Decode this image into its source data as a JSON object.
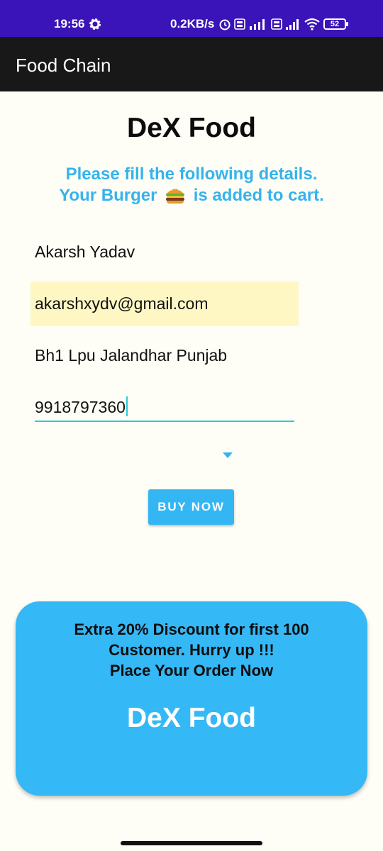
{
  "status_bar": {
    "time": "19:56",
    "network_speed": "0.2KB/s",
    "battery": "52",
    "icons": [
      "gear-icon",
      "alarm-icon",
      "volte-icon",
      "signal-5g-icon",
      "volte-icon",
      "signal-icon",
      "wifi-icon",
      "battery-icon"
    ]
  },
  "app_bar": {
    "title": "Food Chain"
  },
  "header": {
    "brand": "DeX Food",
    "subtitle_line1": "Please fill the following details.",
    "subtitle_line2_before": "Your Burger",
    "subtitle_line2_after": "is added to cart.",
    "subtitle_icon": "burger-emoji-icon"
  },
  "form": {
    "name": "Akarsh Yadav",
    "email": "akarshxydv@gmail.com",
    "address": "Bh1 Lpu Jalandhar Punjab",
    "phone": "9918797360",
    "dropdown_icon": "dropdown-arrow-icon"
  },
  "buy_button": {
    "label": "BUY NOW"
  },
  "promo": {
    "line1": "Extra 20% Discount for first 100",
    "line2": "Customer. Hurry up !!!",
    "line3": "Place Your Order Now",
    "brand": "DeX Food"
  },
  "colors": {
    "status_bar": "#3a14b8",
    "app_bar": "#181818",
    "accent": "#35b3ee",
    "email_highlight": "#fef7c3",
    "phone_underline": "#2bc9d6",
    "background": "#fefef6"
  }
}
